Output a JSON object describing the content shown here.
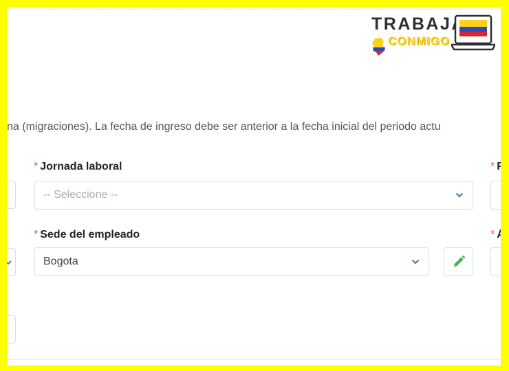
{
  "logo": {
    "line1": "TRABAJA",
    "line2": "CONMIGO"
  },
  "notice_text": "na (migraciones). La fecha de ingreso debe ser anterior a la fecha inicial del periodo actu",
  "form": {
    "required_marker": "*",
    "jornada": {
      "label": "Jornada laboral",
      "placeholder": "-- Seleccione --"
    },
    "sede": {
      "label": "Sede del empleado",
      "value": "Bogota"
    },
    "right_col_label_1": "F",
    "right_col_label_2": "Á"
  },
  "colors": {
    "frame": "#ffff00",
    "required": "#d9534f",
    "chevron": "#4a7fb0",
    "edit_icon": "#4caf50"
  },
  "icons": {
    "dropdown": "chevron-down-icon",
    "edit": "pencil-icon"
  }
}
